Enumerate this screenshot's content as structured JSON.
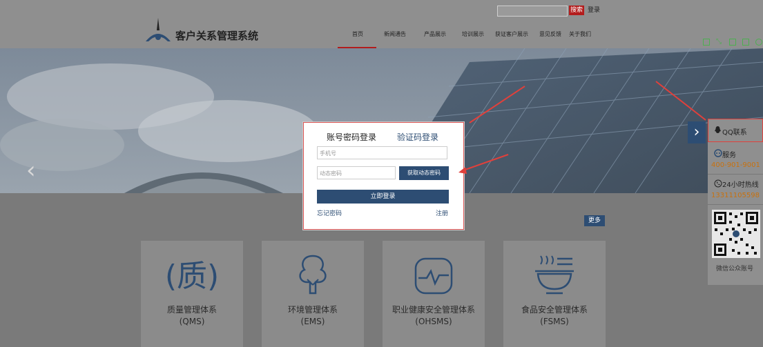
{
  "header": {
    "search_placeholder": "",
    "search_button": "搜索",
    "login_link": "登录",
    "brand": "客户关系管理系统",
    "nav": [
      "首页",
      "新闻通告",
      "产品展示",
      "培训展示",
      "获证客户展示",
      "意见反馈",
      "关于我们"
    ]
  },
  "login": {
    "tab_password": "账号密码登录",
    "tab_code": "验证码登录",
    "phone_placeholder": "手机号",
    "code_placeholder": "动态密码",
    "get_code_button": "获取动态密码",
    "submit_button": "立即登录",
    "forgot_link": "忘记密码",
    "register_link": "注册"
  },
  "main": {
    "more_button": "更多",
    "cards": [
      {
        "title": "质量管理体系",
        "code": "(QMS)",
        "icon": "quality-bracket-icon"
      },
      {
        "title": "环境管理体系",
        "code": "(EMS)",
        "icon": "tree-icon"
      },
      {
        "title": "职业健康安全管理体系",
        "code": "(OHSMS)",
        "icon": "heartbeat-icon"
      },
      {
        "title": "食品安全管理体系",
        "code": "(FSMS)",
        "icon": "food-bowl-icon"
      }
    ]
  },
  "sidebar": {
    "qq": "QQ联系",
    "service_label": "服务",
    "service_phone": "400-901-9001",
    "hotline_label": "24小时热线",
    "hotline_phone": "13311105598",
    "wechat_label": "微信公众账号"
  },
  "colors": {
    "accent": "#2d4d73",
    "red": "#b31c1c",
    "phone_orange": "#c8710e"
  }
}
